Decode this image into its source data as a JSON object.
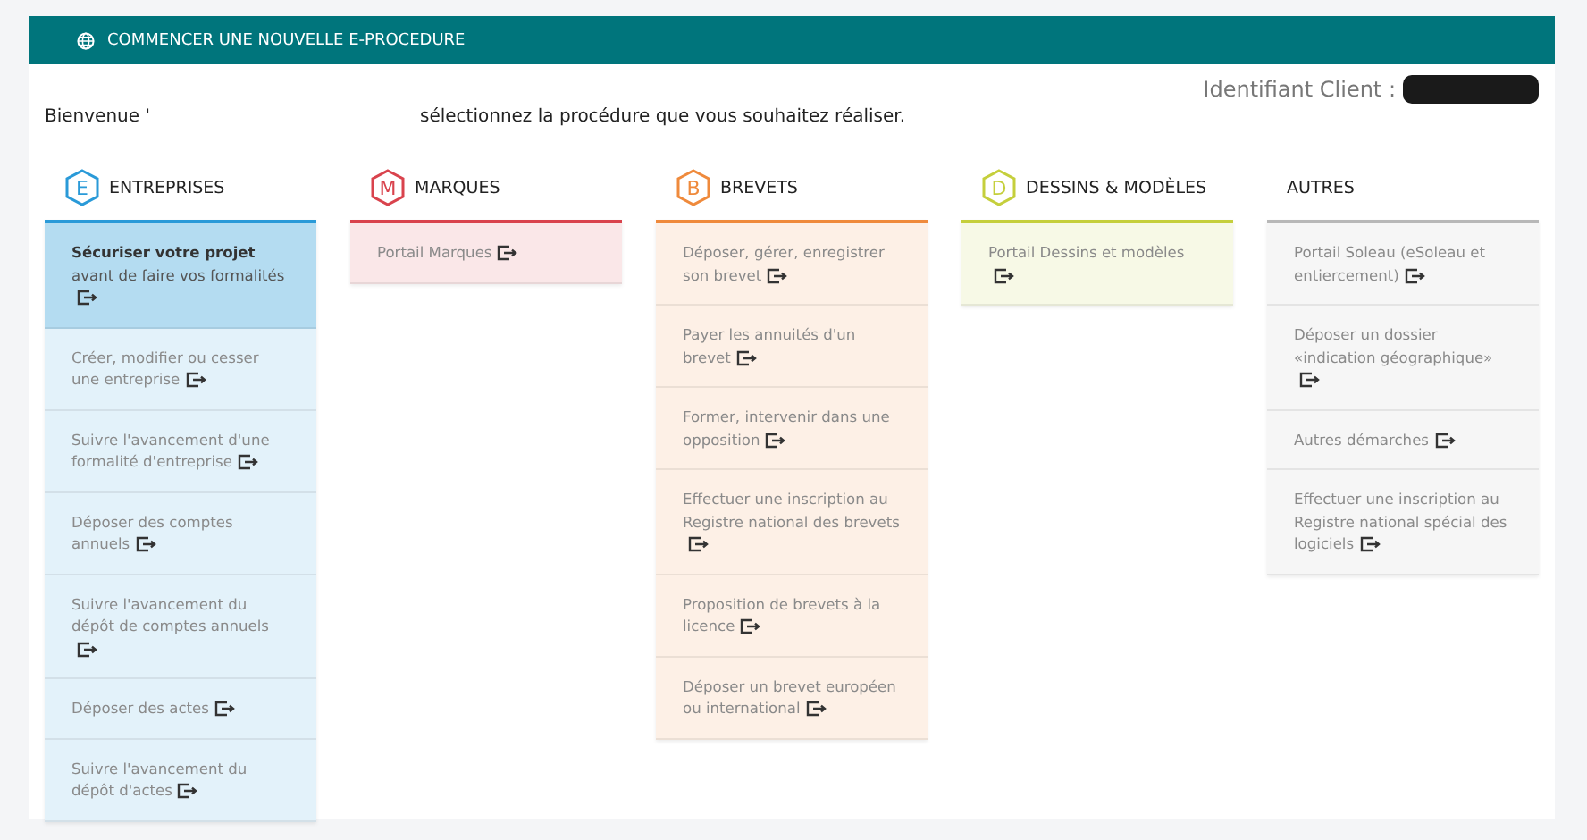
{
  "header": {
    "title": "COMMENCER UNE NOUVELLE E-PROCEDURE"
  },
  "client": {
    "label": "Identifiant Client :",
    "redacted": true
  },
  "welcome": "Bienvenue '",
  "instruction": "sélectionnez la procédure que vous souhaitez réaliser.",
  "columns": [
    {
      "title": "ENTREPRISES",
      "badge": "E",
      "color": "#2a9ad8",
      "items": [
        {
          "text": "**Sécuriser votre projet** avant de faire vos formalités",
          "selected": true
        },
        {
          "text": "Créer, modifier ou cesser une entreprise",
          "selected": false
        },
        {
          "text": "Suivre l'avancement d'une formalité d'entreprise",
          "selected": false
        },
        {
          "text": "Déposer des comptes annuels",
          "selected": false
        },
        {
          "text": "Suivre l'avancement du dépôt de comptes annuels",
          "selected": false
        },
        {
          "text": "Déposer des actes",
          "selected": false
        },
        {
          "text": "Suivre l'avancement du dépôt d'actes",
          "selected": false
        }
      ]
    },
    {
      "title": "MARQUES",
      "badge": "M",
      "color": "#d9434d",
      "items": [
        {
          "text": "Portail Marques",
          "selected": false
        }
      ]
    },
    {
      "title": "BREVETS",
      "badge": "B",
      "color": "#ef8a3c",
      "items": [
        {
          "text": "Déposer, gérer, enregistrer son brevet",
          "selected": false
        },
        {
          "text": "Payer les annuités d'un brevet",
          "selected": false
        },
        {
          "text": "Former, intervenir dans une opposition",
          "selected": false
        },
        {
          "text": "Effectuer une inscription au Registre national des brevets",
          "selected": false
        },
        {
          "text": "Proposition de brevets à la licence",
          "selected": false
        },
        {
          "text": "Déposer un brevet européen ou international",
          "selected": false
        }
      ]
    },
    {
      "title": "DESSINS & MODÈLES",
      "badge": "D",
      "color": "#c5cf3c",
      "items": [
        {
          "text": "Portail Dessins et modèles",
          "selected": false
        }
      ]
    },
    {
      "title": "AUTRES",
      "color": "#b8b8b8",
      "items": [
        {
          "text": "Portail Soleau (eSoleau et entiercement)",
          "selected": false
        },
        {
          "text": "Déposer un dossier «indication géographique»",
          "selected": false
        },
        {
          "text": "Autres démarches",
          "selected": false
        },
        {
          "text": "Effectuer une inscription au Registre national spécial des logiciels",
          "selected": false
        }
      ]
    }
  ]
}
